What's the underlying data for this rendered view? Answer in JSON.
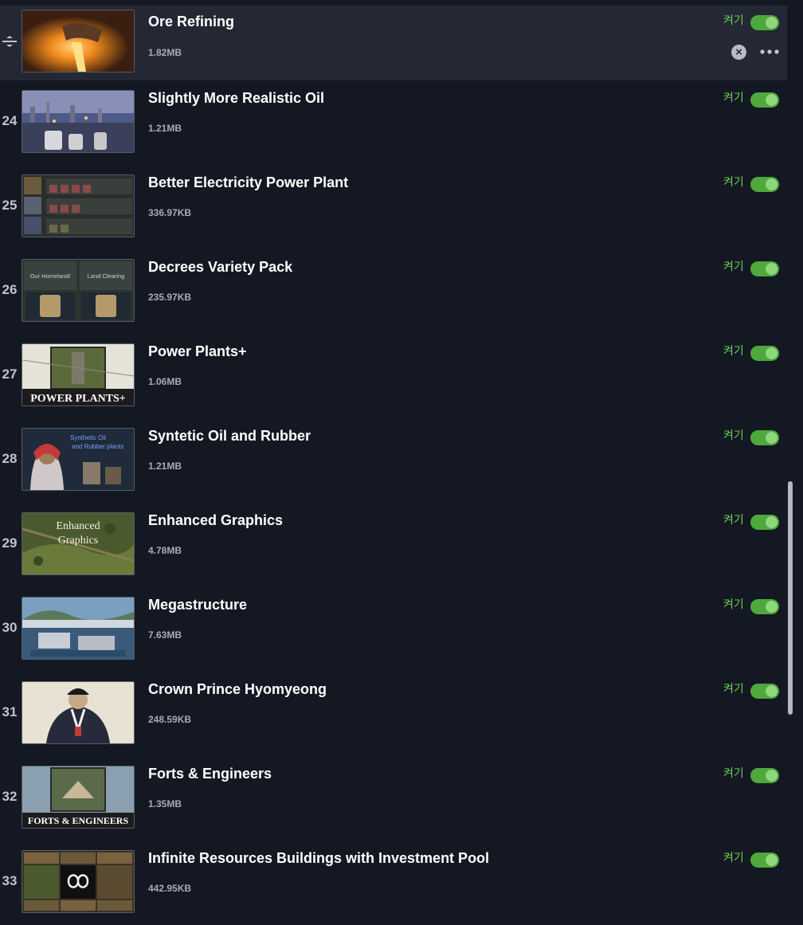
{
  "toggle_label": "켜기",
  "colors": {
    "background": "#141823",
    "selected_row": "#232834",
    "toggle_on": "#4ea83b",
    "toggle_text": "#6ccd56"
  },
  "first_row": {
    "title": "Ore Refining",
    "size": "1.82MB",
    "close_icon": "×"
  },
  "mods": [
    {
      "index": "24",
      "title": "Slightly More Realistic Oil",
      "size": "1.21MB"
    },
    {
      "index": "25",
      "title": "Better Electricity Power Plant",
      "size": "336.97KB"
    },
    {
      "index": "26",
      "title": "Decrees Variety Pack",
      "size": "235.97KB"
    },
    {
      "index": "27",
      "title": "Power Plants+",
      "size": "1.06MB"
    },
    {
      "index": "28",
      "title": "Syntetic Oil and Rubber",
      "size": "1.21MB"
    },
    {
      "index": "29",
      "title": "Enhanced Graphics",
      "size": "4.78MB"
    },
    {
      "index": "30",
      "title": "Megastructure",
      "size": "7.63MB"
    },
    {
      "index": "31",
      "title": "Crown Prince Hyomyeong",
      "size": "248.59KB"
    },
    {
      "index": "32",
      "title": "Forts & Engineers",
      "size": "1.35MB"
    },
    {
      "index": "33",
      "title": "Infinite Resources Buildings with Investment Pool",
      "size": "442.95KB"
    }
  ],
  "thumb_text": {
    "homeland": "Our Homeland!",
    "land_clearing": "Land Clearing",
    "power_plants": "POWER PLANTS+",
    "synthetic": "Synthetic Oil",
    "rubber_plants": "and Rubber plants",
    "enhanced": "Enhanced",
    "graphics": "Graphics",
    "forts": "FORTS & ENGINEERS"
  }
}
